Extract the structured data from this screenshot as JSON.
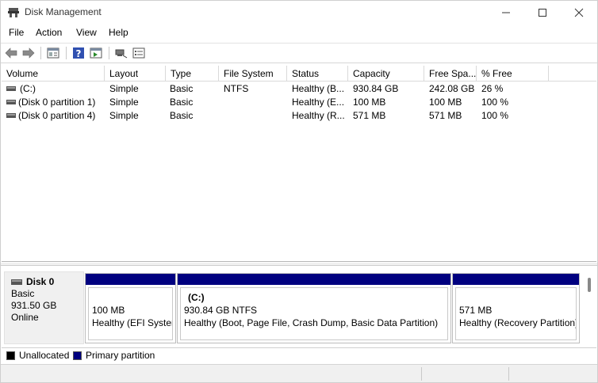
{
  "window": {
    "title": "Disk Management"
  },
  "menu": [
    "File",
    "Action",
    "View",
    "Help"
  ],
  "toolbar": {
    "buttons": [
      "back-arrow-icon",
      "forward-arrow-icon",
      "properties-icon",
      "help-icon",
      "console-tree-icon",
      "rescan-icon",
      "settings-list-icon"
    ]
  },
  "volumes": {
    "columns": [
      "Volume",
      "Layout",
      "Type",
      "File System",
      "Status",
      "Capacity",
      "Free Spa...",
      "% Free"
    ],
    "rows": [
      {
        "volume": "(C:)",
        "layout": "Simple",
        "type": "Basic",
        "fs": "NTFS",
        "status": "Healthy (B...",
        "capacity": "930.84 GB",
        "free": "242.08 GB",
        "pct": "26 %"
      },
      {
        "volume": "(Disk 0 partition 1)",
        "layout": "Simple",
        "type": "Basic",
        "fs": "",
        "status": "Healthy (E...",
        "capacity": "100 MB",
        "free": "100 MB",
        "pct": "100 %"
      },
      {
        "volume": "(Disk 0 partition 4)",
        "layout": "Simple",
        "type": "Basic",
        "fs": "",
        "status": "Healthy (R...",
        "capacity": "571 MB",
        "free": "571 MB",
        "pct": "100 %"
      }
    ]
  },
  "disk": {
    "name": "Disk 0",
    "type": "Basic",
    "size": "931.50 GB",
    "state": "Online",
    "partitions": [
      {
        "name": "",
        "size": "100 MB",
        "status": "Healthy (EFI System Partition)"
      },
      {
        "name": "(C:)",
        "size": "930.84 GB NTFS",
        "status": "Healthy (Boot, Page File, Crash Dump, Basic Data Partition)"
      },
      {
        "name": "",
        "size": "571 MB",
        "status": "Healthy (Recovery Partition)"
      }
    ]
  },
  "legend": {
    "unallocated": "Unallocated",
    "primary": "Primary partition",
    "unallocated_color": "#000000",
    "primary_color": "#00007f"
  }
}
